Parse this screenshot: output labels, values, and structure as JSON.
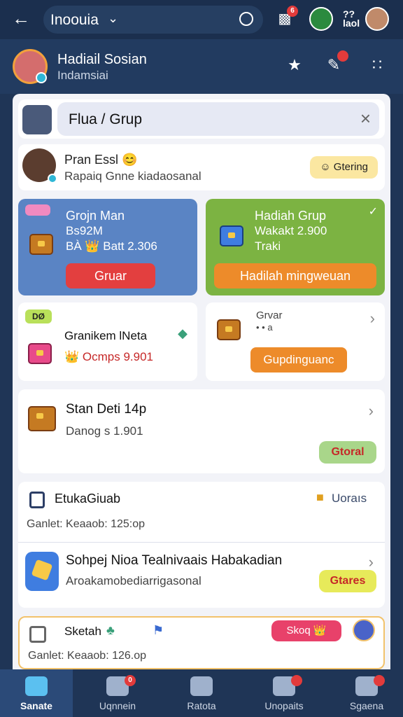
{
  "topbar": {
    "search_text": "Inoouia",
    "right_label": "??\nlaol"
  },
  "profile": {
    "name": "Hadiail Sosian",
    "subtitle": "Indamsiai"
  },
  "sheet": {
    "header_title": "Flua / Grup",
    "friend": {
      "name": "Pran Essl 😊",
      "subtitle": "Rapaiq Gnne kiadaosanal",
      "button": "☺ Gtering"
    },
    "tile_blue": {
      "title": "Grojn Man",
      "line2": "Bs92M",
      "line3": "BÀ 👑 Batt 2.306",
      "button": "Gruar"
    },
    "tile_green": {
      "title": "Hadiah Grup",
      "line2": "Wakakt 2.900",
      "line3": "Traki",
      "button": "Hadilah mingweuan"
    },
    "tile_left": {
      "badge": "DØ",
      "title": "Granikem lNeta",
      "sub": "👑 Ocmps 9.901"
    },
    "tile_right": {
      "title": "Grvar",
      "sub": "• • a",
      "button": "Gupdinguanc"
    },
    "card1": {
      "title": "Stan Deti 14p",
      "sub": "Danog s 1.901",
      "button": "Gtoral"
    },
    "card2": {
      "row1_title": "EtukaGiuab",
      "row1_right": "Uoraıs",
      "row1_sub": "Ganlet: Keaaob: 125:op",
      "row2_title": "Sohpej Nioa Tealnivaais Habakadian",
      "row2_sub": "Aroakamobediarrigasonal",
      "row2_button": "Gtares"
    },
    "card3": {
      "title": "Sketah",
      "sub": "Ganlet: Keaaob: 126.op",
      "pink_button": "Skoq 👑"
    }
  },
  "tabs": [
    {
      "label": "Sanate",
      "active": true
    },
    {
      "label": "Uqnnein",
      "active": false
    },
    {
      "label": "Ratota",
      "active": false
    },
    {
      "label": "Unopaits",
      "active": false
    },
    {
      "label": "Sgaena",
      "active": false
    }
  ],
  "badges": {
    "top_notif": "6",
    "tab_badge": "0"
  }
}
